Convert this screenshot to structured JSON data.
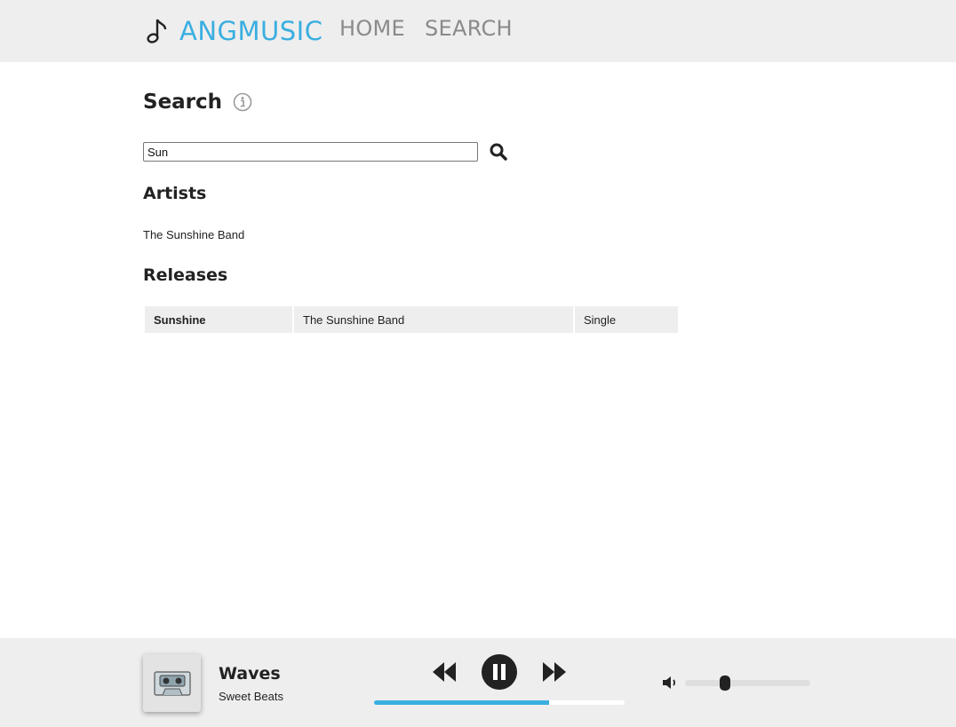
{
  "header": {
    "brand": "ANGMUSIC",
    "nav": {
      "home": "HOME",
      "search": "SEARCH"
    },
    "brand_color": "#3aaee0"
  },
  "search": {
    "title": "Search",
    "query": "Sun",
    "icons": {
      "info": "info-icon",
      "submit": "search-icon"
    }
  },
  "artists": {
    "heading": "Artists",
    "items": [
      {
        "name": "The Sunshine Band"
      }
    ]
  },
  "releases": {
    "heading": "Releases",
    "rows": [
      {
        "title": "Sunshine",
        "artist": "The Sunshine Band",
        "type": "Single"
      }
    ]
  },
  "player": {
    "track_title": "Waves",
    "track_artist": "Sweet Beats",
    "state": "playing",
    "progress_fraction": 0.7,
    "volume_fraction": 0.32,
    "accent_color": "#3aaee0",
    "icons": {
      "prev": "rewind-icon",
      "pause": "pause-icon",
      "next": "fast-forward-icon",
      "volume": "volume-icon",
      "cover": "cassette-icon"
    }
  }
}
